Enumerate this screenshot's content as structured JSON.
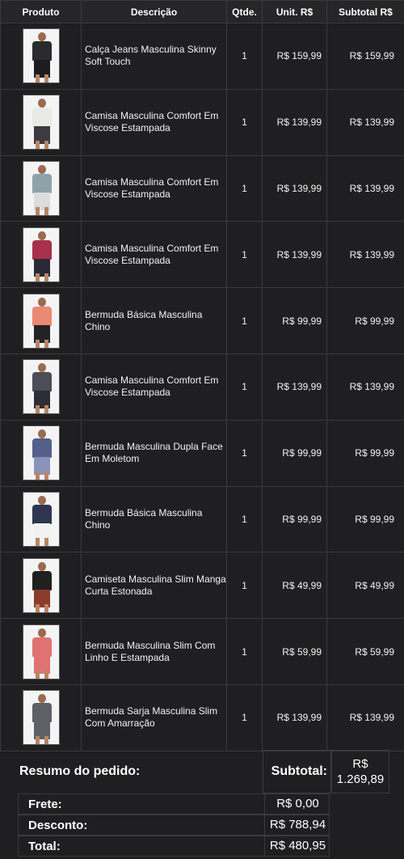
{
  "headers": {
    "product": "Produto",
    "description": "Descrição",
    "qty": "Qtde.",
    "unit": "Unit. R$",
    "subtotal": "Subtotal R$"
  },
  "items": [
    {
      "desc": "Calça Jeans Masculina Skinny Soft Touch",
      "qty": "1",
      "unit": "R$ 159,99",
      "subtotal": "R$ 159,99",
      "top": "#2b2b2e",
      "bottom": "#1d1d20"
    },
    {
      "desc": "Camisa Masculina Comfort Em Viscose Estampada",
      "qty": "1",
      "unit": "R$ 139,99",
      "subtotal": "R$ 139,99",
      "top": "#e9e9e6",
      "bottom": "#3b3b40"
    },
    {
      "desc": "Camisa Masculina Comfort Em Viscose Estampada",
      "qty": "1",
      "unit": "R$ 139,99",
      "subtotal": "R$ 139,99",
      "top": "#8fa2a7",
      "bottom": "#dcdcdc"
    },
    {
      "desc": "Camisa Masculina Comfort Em Viscose Estampada",
      "qty": "1",
      "unit": "R$ 139,99",
      "subtotal": "R$ 139,99",
      "top": "#a8304a",
      "bottom": "#2a2a36"
    },
    {
      "desc": "Bermuda Básica Masculina Chino",
      "qty": "1",
      "unit": "R$ 99,99",
      "subtotal": "R$ 99,99",
      "top": "#e98a74",
      "bottom": "#232327"
    },
    {
      "desc": "Camisa Masculina Comfort Em Viscose Estampada",
      "qty": "1",
      "unit": "R$ 139,99",
      "subtotal": "R$ 139,99",
      "top": "#4b4e57",
      "bottom": "#2d2d35"
    },
    {
      "desc": "Bermuda Masculina Dupla Face Em Moletom",
      "qty": "1",
      "unit": "R$ 99,99",
      "subtotal": "R$ 99,99",
      "top": "#54608a",
      "bottom": "#8a93b8"
    },
    {
      "desc": "Bermuda Básica Masculina Chino",
      "qty": "1",
      "unit": "R$ 99,99",
      "subtotal": "R$ 99,99",
      "top": "#2d3550",
      "bottom": "#f2f2f2"
    },
    {
      "desc": "Camiseta Masculina Slim Manga Curta Estonada",
      "qty": "1",
      "unit": "R$ 49,99",
      "subtotal": "R$ 49,99",
      "top": "#202020",
      "bottom": "#8a3c2a"
    },
    {
      "desc": "Bermuda Masculina Slim Com Linho E Estampada",
      "qty": "1",
      "unit": "R$ 59,99",
      "subtotal": "R$ 59,99",
      "top": "#e07272",
      "bottom": "#e07272"
    },
    {
      "desc": "Bermuda Sarja Masculina Slim Com Amarração",
      "qty": "1",
      "unit": "R$ 139,99",
      "subtotal": "R$ 139,99",
      "top": "#5d6166",
      "bottom": "#5d6166"
    }
  ],
  "summary": {
    "title": "Resumo do pedido:",
    "subtotal_label": "Subtotal:",
    "subtotal_currency": "R$",
    "subtotal_value": "1.269,89",
    "shipping_label": "Frete:",
    "shipping_value": "R$ 0,00",
    "discount_label": "Desconto:",
    "discount_value": "R$ 788,94",
    "total_label": "Total:",
    "total_value": "R$ 480,95"
  }
}
